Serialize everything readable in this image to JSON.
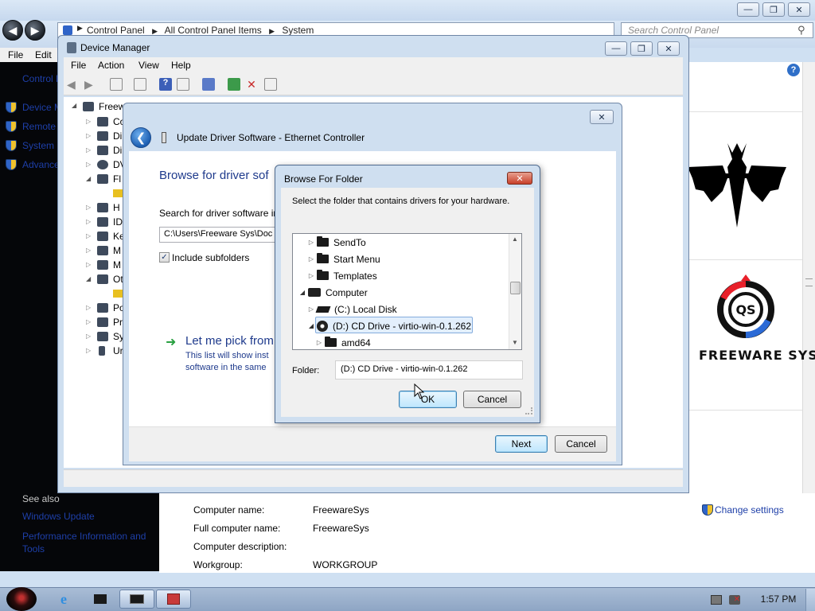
{
  "control_panel": {
    "breadcrumb": [
      "Control Panel",
      "All Control Panel Items",
      "System"
    ],
    "search_placeholder": "Search Control Panel",
    "menu": [
      "File",
      "Edit"
    ],
    "left_pane": {
      "title": "Control Panel Home",
      "links": [
        "Device Manager",
        "Remote settings",
        "System protection",
        "Advanced system settings"
      ],
      "see_also_header": "See also",
      "see_also_links": [
        "Windows Update",
        "Performance Information and Tools"
      ]
    },
    "computer_info": {
      "rows": [
        {
          "label": "Computer name:",
          "value": "FreewareSys"
        },
        {
          "label": "Full computer name:",
          "value": "FreewareSys"
        },
        {
          "label": "Computer description:",
          "value": ""
        },
        {
          "label": "Workgroup:",
          "value": "WORKGROUP"
        }
      ],
      "change_settings": "Change settings"
    },
    "logo_text": "FREEWARE SYS",
    "logo_monogram": "QS"
  },
  "device_manager": {
    "title": "Device Manager",
    "menu": [
      "File",
      "Action",
      "View",
      "Help"
    ],
    "tree": {
      "root": "Freew",
      "items": [
        {
          "label": "Co",
          "expanded": false
        },
        {
          "label": "Di",
          "expanded": false
        },
        {
          "label": "Di",
          "expanded": false
        },
        {
          "label": "DV",
          "expanded": false
        },
        {
          "label": "Fl",
          "expanded": true
        },
        {
          "label": "",
          "expanded": false
        },
        {
          "label": "H",
          "expanded": false
        },
        {
          "label": "ID",
          "expanded": false
        },
        {
          "label": "Ke",
          "expanded": false
        },
        {
          "label": "M",
          "expanded": false
        },
        {
          "label": "M",
          "expanded": false
        },
        {
          "label": "Ot",
          "expanded": true
        },
        {
          "label": "",
          "expanded": false
        },
        {
          "label": "Po",
          "expanded": false
        },
        {
          "label": "Pr",
          "expanded": false
        },
        {
          "label": "Sy",
          "expanded": false
        },
        {
          "label": "Ur",
          "expanded": false
        }
      ]
    }
  },
  "update_driver": {
    "title": "Update Driver Software - Ethernet Controller",
    "heading": "Browse for driver sof",
    "search_label": "Search for driver software in",
    "path_value": "C:\\Users\\Freeware Sys\\Doc",
    "include_subfolders": "Include subfolders",
    "pick_title": "Let me pick from",
    "pick_desc_line1": "This list will show inst",
    "pick_desc_line2": "software in the same",
    "next_button": "Next",
    "cancel_button": "Cancel"
  },
  "browse_folder": {
    "title": "Browse For Folder",
    "instruction": "Select the folder that contains drivers for your hardware.",
    "tree": [
      {
        "label": "SendTo",
        "icon": "folder-icon",
        "expander": "collapsed"
      },
      {
        "label": "Start Menu",
        "icon": "folder-icon",
        "expander": "collapsed"
      },
      {
        "label": "Templates",
        "icon": "folder-icon",
        "expander": "collapsed"
      },
      {
        "label": "Computer",
        "icon": "computer-icon",
        "expander": "expanded"
      },
      {
        "label": "(C:) Local Disk",
        "icon": "local-disk-icon",
        "expander": "collapsed"
      },
      {
        "label": "(D:) CD Drive - virtio-win-0.1.262",
        "icon": "cd-drive-icon",
        "expander": "expanded",
        "selected": true
      },
      {
        "label": "amd64",
        "icon": "folder-icon",
        "expander": "collapsed"
      }
    ],
    "folder_label": "Folder:",
    "folder_value": "(D:) CD Drive - virtio-win-0.1.262",
    "ok_button": "OK",
    "cancel_button": "Cancel"
  },
  "taskbar": {
    "clock": "1:57 PM"
  },
  "colors": {
    "accent_link": "#1e3a8c",
    "selection": "#e3effc",
    "close_button": "#c8402a"
  }
}
